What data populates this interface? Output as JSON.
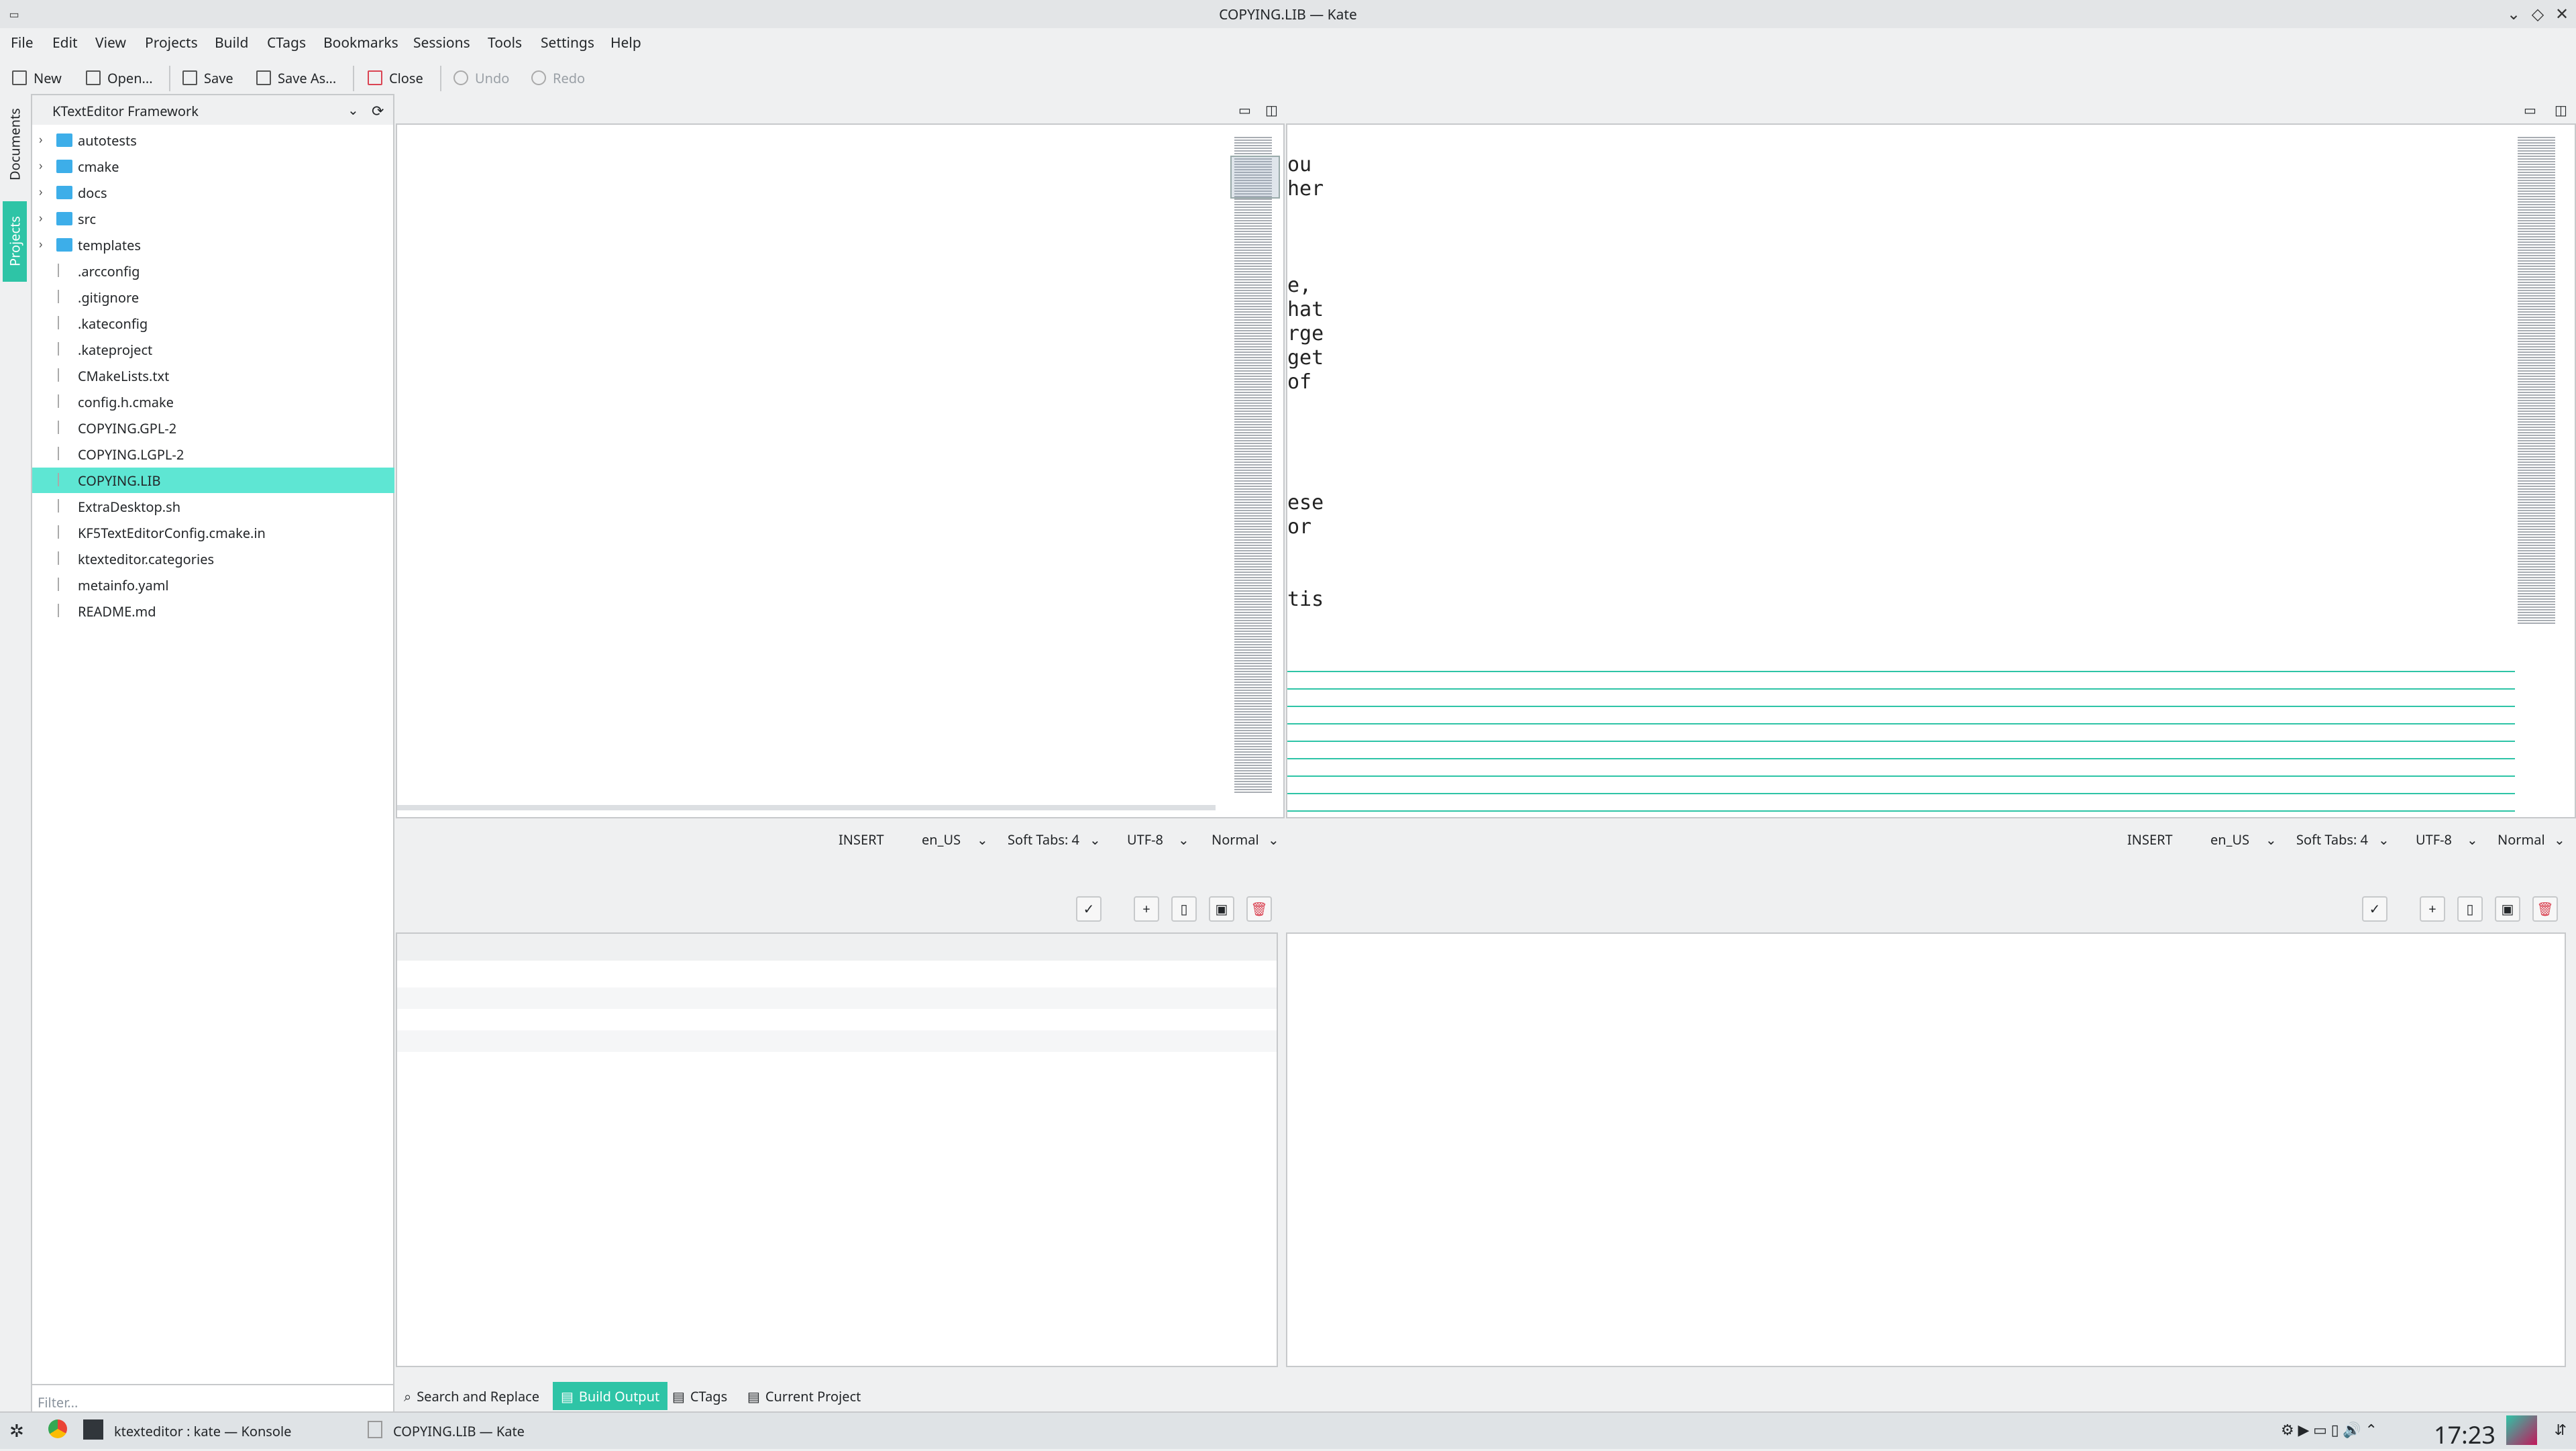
{
  "window": {
    "title": "COPYING.LIB — Kate"
  },
  "menu": [
    "File",
    "Edit",
    "View",
    "Projects",
    "Build",
    "CTags",
    "Bookmarks",
    "Sessions",
    "Tools",
    "Settings",
    "Help"
  ],
  "toolbar": {
    "new": "New",
    "open": "Open...",
    "save": "Save",
    "save_as": "Save As...",
    "close": "Close",
    "undo": "Undo",
    "redo": "Redo"
  },
  "side_tabs": {
    "documents": "Documents",
    "projects": "Projects"
  },
  "project": {
    "name": "KTextEditor Framework",
    "items": [
      {
        "label": "autotests",
        "type": "folder"
      },
      {
        "label": "cmake",
        "type": "folder"
      },
      {
        "label": "docs",
        "type": "folder"
      },
      {
        "label": "src",
        "type": "folder"
      },
      {
        "label": "templates",
        "type": "folder"
      },
      {
        "label": ".arcconfig",
        "type": "file"
      },
      {
        "label": ".gitignore",
        "type": "file"
      },
      {
        "label": ".kateconfig",
        "type": "file"
      },
      {
        "label": ".kateproject",
        "type": "file"
      },
      {
        "label": "CMakeLists.txt",
        "type": "file"
      },
      {
        "label": "config.h.cmake",
        "type": "file"
      },
      {
        "label": "COPYING.GPL-2",
        "type": "file"
      },
      {
        "label": "COPYING.LGPL-2",
        "type": "file"
      },
      {
        "label": "COPYING.LIB",
        "type": "file"
      },
      {
        "label": "ExtraDesktop.sh",
        "type": "file"
      },
      {
        "label": "KF5TextEditorConfig.cmake.in",
        "type": "file"
      },
      {
        "label": "ktexteditor.categories",
        "type": "file"
      },
      {
        "label": "metainfo.yaml",
        "type": "file"
      },
      {
        "label": "README.md",
        "type": "file"
      }
    ],
    "filter_placeholder": "Filter..."
  },
  "editor_right_lines": [
    "ou",
    "her",
    "",
    "",
    "",
    "e,",
    "hat",
    "rge",
    "get",
    "of",
    "",
    "",
    "",
    "",
    "ese",
    "or",
    "",
    "",
    "tis"
  ],
  "status_left": {
    "mode": "INSERT",
    "lang": "en_US",
    "indent": "Soft Tabs: 4",
    "encoding": "UTF-8",
    "mode2": "Normal"
  },
  "status_right": {
    "mode": "INSERT",
    "lang": "en_US",
    "indent": "Soft Tabs: 4",
    "encoding": "UTF-8",
    "mode2": "Normal"
  },
  "bottom_tabs": [
    "Search and Replace",
    "Build Output",
    "CTags",
    "Current Project"
  ],
  "taskbar": {
    "konsole": "ktexteditor : kate — Konsole",
    "kate": "COPYING.LIB — Kate",
    "time": "17:23"
  },
  "colors": {
    "accent": "#2ec4a6",
    "selection": "#5ee6d3"
  }
}
